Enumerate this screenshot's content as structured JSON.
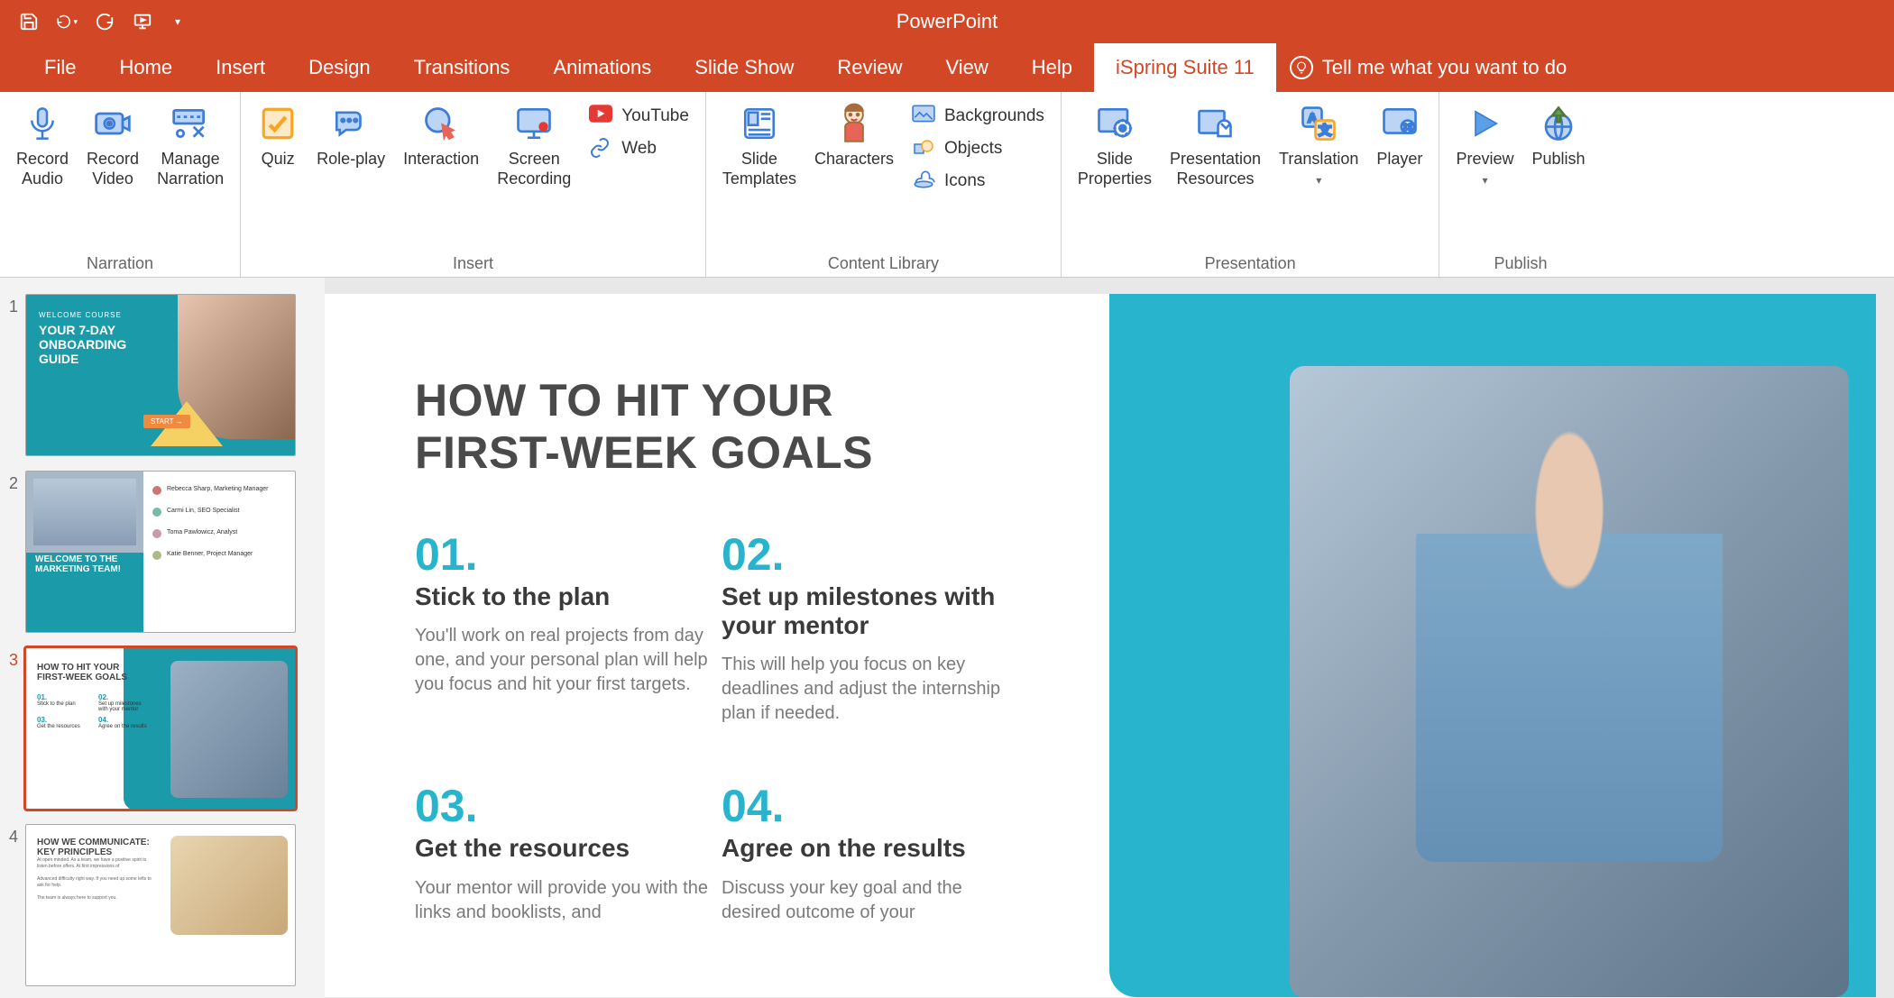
{
  "app_title": "PowerPoint",
  "qat": {
    "save": "save",
    "undo": "undo",
    "redo": "redo",
    "present": "present-from-beginning"
  },
  "tabs": [
    "File",
    "Home",
    "Insert",
    "Design",
    "Transitions",
    "Animations",
    "Slide Show",
    "Review",
    "View",
    "Help",
    "iSpring Suite 11"
  ],
  "active_tab": "iSpring Suite 11",
  "tell_me": "Tell me what you want to do",
  "ribbon": {
    "groups": [
      {
        "label": "Narration",
        "buttons": [
          {
            "id": "record-audio",
            "label": "Record\nAudio"
          },
          {
            "id": "record-video",
            "label": "Record\nVideo"
          },
          {
            "id": "manage-narration",
            "label": "Manage\nNarration"
          }
        ]
      },
      {
        "label": "Insert",
        "buttons": [
          {
            "id": "quiz",
            "label": "Quiz"
          },
          {
            "id": "role-play",
            "label": "Role-play"
          },
          {
            "id": "interaction",
            "label": "Interaction"
          },
          {
            "id": "screen-recording",
            "label": "Screen\nRecording"
          }
        ],
        "small": [
          {
            "id": "youtube",
            "label": "YouTube"
          },
          {
            "id": "web",
            "label": "Web"
          }
        ]
      },
      {
        "label": "Content Library",
        "buttons": [
          {
            "id": "slide-templates",
            "label": "Slide\nTemplates"
          },
          {
            "id": "characters",
            "label": "Characters"
          }
        ],
        "small": [
          {
            "id": "backgrounds",
            "label": "Backgrounds"
          },
          {
            "id": "objects",
            "label": "Objects"
          },
          {
            "id": "icons",
            "label": "Icons"
          }
        ]
      },
      {
        "label": "Presentation",
        "buttons": [
          {
            "id": "slide-properties",
            "label": "Slide\nProperties"
          },
          {
            "id": "presentation-resources",
            "label": "Presentation\nResources"
          },
          {
            "id": "translation",
            "label": "Translation",
            "dropdown": true
          },
          {
            "id": "player",
            "label": "Player"
          }
        ]
      },
      {
        "label": "Publish",
        "buttons": [
          {
            "id": "preview",
            "label": "Preview",
            "dropdown": true
          },
          {
            "id": "publish",
            "label": "Publish"
          }
        ]
      }
    ]
  },
  "thumbnails": [
    {
      "num": "1",
      "title": "YOUR 7-DAY ONBOARDING GUIDE",
      "subtitle": "WELCOME COURSE",
      "button": "START →"
    },
    {
      "num": "2",
      "title": "WELCOME TO THE MARKETING TEAM!",
      "people": [
        "Rebecca Sharp, Marketing Manager",
        "Carmi Lin, SEO Specialist",
        "Toma Pawlowicz, Analyst",
        "Katie Benner, Project Manager"
      ]
    },
    {
      "num": "3",
      "title": "HOW TO HIT YOUR FIRST-WEEK GOALS",
      "selected": true
    },
    {
      "num": "4",
      "title": "HOW WE COMMUNICATE: KEY PRINCIPLES"
    }
  ],
  "slide": {
    "title_l1": "HOW TO HIT YOUR",
    "title_l2": "FIRST-WEEK GOALS",
    "goals": [
      {
        "n": "01.",
        "h": "Stick to the plan",
        "b": "You'll work on real projects from day one, and your personal plan will help you focus and hit your first targets."
      },
      {
        "n": "02.",
        "h": "Set up milestones with your mentor",
        "b": "This will help you focus on key deadlines and adjust the internship plan if needed."
      },
      {
        "n": "03.",
        "h": "Get the resources",
        "b": "Your mentor will provide you with the links and booklists, and"
      },
      {
        "n": "04.",
        "h": "Agree on the results",
        "b": "Discuss your key goal and the desired outcome of your"
      }
    ]
  }
}
